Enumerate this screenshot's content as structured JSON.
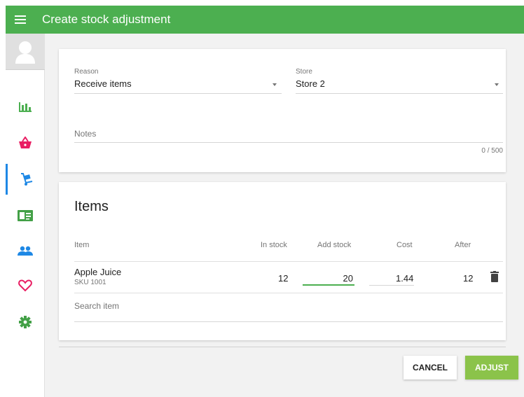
{
  "header": {
    "title": "Create stock adjustment"
  },
  "sidebar": {
    "items": [
      {
        "icon": "bar-chart-icon",
        "color": "#4caf50"
      },
      {
        "icon": "basket-icon",
        "color": "#e91e63"
      },
      {
        "icon": "dolly-icon",
        "color": "#1e88e5",
        "active": true
      },
      {
        "icon": "id-card-icon",
        "color": "#43a047"
      },
      {
        "icon": "people-icon",
        "color": "#1e88e5"
      },
      {
        "icon": "heart-icon",
        "color": "#e91e63"
      },
      {
        "icon": "gear-icon",
        "color": "#43a047"
      }
    ]
  },
  "form": {
    "reason_label": "Reason",
    "reason_value": "Receive items",
    "store_label": "Store",
    "store_value": "Store 2",
    "notes_label": "Notes",
    "notes_counter": "0 / 500"
  },
  "items": {
    "title": "Items",
    "columns": {
      "item": "Item",
      "in_stock": "In stock",
      "add_stock": "Add stock",
      "cost": "Cost",
      "after": "After"
    },
    "rows": [
      {
        "name": "Apple Juice",
        "sku": "SKU 1001",
        "in_stock": "12",
        "add_stock": "20",
        "cost": "1.44",
        "after": "12"
      }
    ],
    "search_placeholder": "Search item"
  },
  "actions": {
    "cancel_label": "CANCEL",
    "adjust_label": "ADJUST"
  },
  "colors": {
    "primary": "#4caf50",
    "adjust_button": "#8bc34a",
    "active_nav": "#1e88e5"
  }
}
